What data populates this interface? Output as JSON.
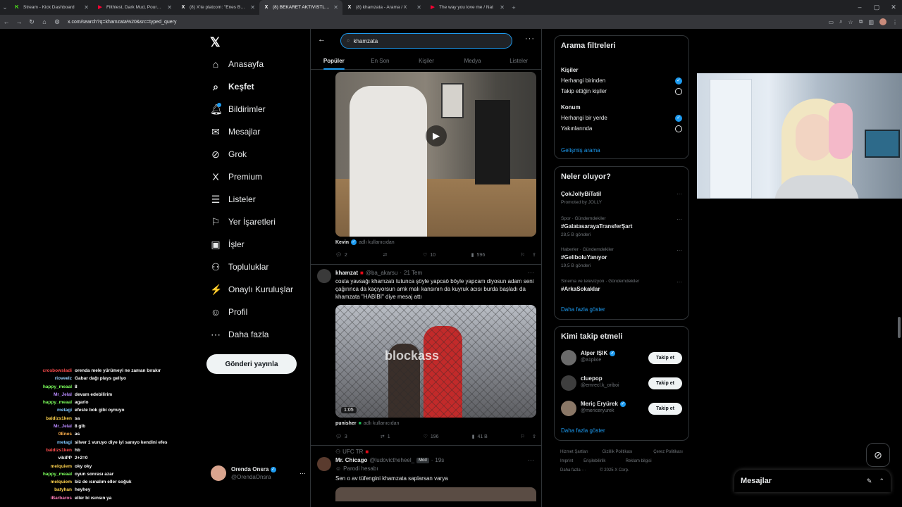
{
  "browser": {
    "tabs": [
      {
        "title": "Stream - Kick Dashboard",
        "icon": "K",
        "color": "#53fc18"
      },
      {
        "title": "Filthiest, Dark Mud, Poured Fro",
        "icon": "▶",
        "color": "#ff0033"
      },
      {
        "title": "(8) X'te platcom: \"Enes Batur, \"",
        "icon": "X",
        "color": "#ffffff"
      },
      {
        "title": "(8) BEKARET AKTIVİSTLERİ Top",
        "icon": "X",
        "color": "#ffffff"
      },
      {
        "title": "(8) khamzata - Arama / X",
        "icon": "X",
        "color": "#ffffff"
      },
      {
        "title": "The way you love me / Nat",
        "icon": "▶",
        "color": "#ff0033"
      }
    ],
    "active_tab": 3,
    "url": "x.com/search?q=khamzata%20&src=typed_query"
  },
  "nav": {
    "items": [
      {
        "label": "Anasayfa",
        "icon": "⌂",
        "icon_name": "home-icon"
      },
      {
        "label": "Keşfet",
        "icon": "⌕",
        "icon_name": "search-icon"
      },
      {
        "label": "Bildirimler",
        "icon": "🔔︎",
        "icon_name": "bell-icon"
      },
      {
        "label": "Mesajlar",
        "icon": "✉",
        "icon_name": "mail-icon"
      },
      {
        "label": "Grok",
        "icon": "⊘",
        "icon_name": "grok-icon"
      },
      {
        "label": "Premium",
        "icon": "X",
        "icon_name": "x-premium-icon"
      },
      {
        "label": "Listeler",
        "icon": "☰",
        "icon_name": "list-icon"
      },
      {
        "label": "Yer İşaretleri",
        "icon": "⚐",
        "icon_name": "bookmark-icon"
      },
      {
        "label": "İşler",
        "icon": "▣",
        "icon_name": "briefcase-icon"
      },
      {
        "label": "Topluluklar",
        "icon": "⚇",
        "icon_name": "communities-icon"
      },
      {
        "label": "Onaylı Kuruluşlar",
        "icon": "⚡",
        "icon_name": "lightning-icon"
      },
      {
        "label": "Profil",
        "icon": "☺",
        "icon_name": "profile-icon"
      },
      {
        "label": "Daha fazla",
        "icon": "⋯",
        "icon_name": "more-icon"
      }
    ],
    "post_button": "Gönderi yayınla",
    "account": {
      "name": "Orenda Onsra",
      "handle": "@OrendaOnsra"
    }
  },
  "search": {
    "query": "khamzata",
    "tabs": [
      "Popüler",
      "En Son",
      "Kişiler",
      "Medya",
      "Listeler"
    ]
  },
  "feed": {
    "post1": {
      "caption_name": "Kevin",
      "caption_suffix": "adlı kullanıcıdan",
      "replies": "2",
      "likes": "10",
      "views": "596"
    },
    "post2": {
      "name": "khamzat",
      "handle": "@ba_akarsu",
      "date": "21 Tem",
      "text": "costa yavsağı khamzatı tutunca şöyle yapcaö böyle yapcam diyosun adam seni çağırınca da kaçıyorsun amk malı kansının da kuyruk acısı burda başladı da khamzata \"HABİBİ\" diye mesaj attı",
      "duration": "1:05",
      "watermark": "blockass",
      "caption_name": "punisher",
      "caption_suffix": "adlı kullanıcıdan",
      "replies": "3",
      "retweets": "1",
      "likes": "196",
      "views": "41 B"
    },
    "post3": {
      "context": "UFC TR",
      "name": "Mr. Chicago",
      "handle": "@ludovictheheel_",
      "badge": "Mod",
      "time": "19s",
      "label": "Parodi hesabı",
      "text": "Sen o av tüfengini khamzata saplarsan varya"
    }
  },
  "filters": {
    "title": "Arama filtreleri",
    "people_title": "Kişiler",
    "people_opts": [
      "Herhangi birinden",
      "Takip ettiğin kişiler"
    ],
    "location_title": "Konum",
    "location_opts": [
      "Herhangi bir yerde",
      "Yakınlarında"
    ],
    "advanced": "Gelişmiş arama"
  },
  "trends": {
    "title": "Neler oluyor?",
    "items": [
      {
        "meta": "",
        "name": "ÇokJollyBiTatil",
        "sub": "Promoted by JOLLY"
      },
      {
        "meta": "Spor · Gündemdekiler",
        "name": "#GalatasarayaTransferŞart",
        "sub": "28,5 B gönderi"
      },
      {
        "meta": "Haberler · Gündemdekiler",
        "name": "#GeliboluYanıyor",
        "sub": "19,5 B gönderi"
      },
      {
        "meta": "Sinema ve televizyon · Gündemdekiler",
        "name": "#ArkaSokaklar",
        "sub": ""
      }
    ],
    "more": "Daha fazla göster"
  },
  "who_to_follow": {
    "title": "Kimi takip etmeli",
    "items": [
      {
        "name": "Alper IŞIK",
        "handle": "@a1pixie",
        "verified": true,
        "color": "#6b6b6b"
      },
      {
        "name": "cluepop",
        "handle": "@emrecl.k_oriboi",
        "verified": false,
        "color": "#3e3e3e"
      },
      {
        "name": "Meriç Eryürek",
        "handle": "@mericeryurek",
        "verified": true,
        "color": "#8a7766"
      }
    ],
    "follow_label": "Takip et",
    "more": "Daha fazla göster"
  },
  "footer": {
    "row1": [
      "Hizmet Şartları",
      "Gizlilik Politikası",
      "Çerez Politikası"
    ],
    "row2": [
      "Imprint",
      "Erişilebilirlik",
      "Reklam bilgisi"
    ],
    "row3": [
      "Daha fazla ···",
      "© 2025 X Corp."
    ]
  },
  "chat": [
    {
      "user": "crosbowsladi",
      "msg": "orenda mele yürümeyi ne zaman bırakır",
      "color": "#ff4d4d"
    },
    {
      "user": "rioveelz",
      "msg": "Gabar dağı plays geliyo",
      "color": "#9ad3ff"
    },
    {
      "user": "happy_meaal",
      "msg": "8",
      "color": "#7cff5c"
    },
    {
      "user": "Mr_Jelal",
      "msg": "devam edebilirim",
      "color": "#b98aff"
    },
    {
      "user": "happy_meaal",
      "msg": "agario",
      "color": "#7cff5c"
    },
    {
      "user": "metagi",
      "msg": "efeste bok gibi oynuyo",
      "color": "#7fc8ff"
    },
    {
      "user": "baldizs1ken",
      "msg": "sa",
      "color": "#ffd34d"
    },
    {
      "user": "Mr_Jelal",
      "msg": "8 glb",
      "color": "#b98aff"
    },
    {
      "user": "0Enes",
      "msg": "as",
      "color": "#ffb14d"
    },
    {
      "user": "metagi",
      "msg": "silver 1 vuruyo diye iyi sanıyo kendini efes",
      "color": "#7fc8ff"
    },
    {
      "user": "baldizs1ken",
      "msg": "hb",
      "color": "#ff4d4d"
    },
    {
      "user": "vikiPP",
      "msg": "2+2=0",
      "color": "#ffffff"
    },
    {
      "user": "melquiem",
      "msg": "oky oky",
      "color": "#ffd34d"
    },
    {
      "user": "happy_meaal",
      "msg": "oyun sonrası azar",
      "color": "#7cff5c"
    },
    {
      "user": "melquiem",
      "msg": "biz de ısınalım eller soğuk",
      "color": "#ffd34d"
    },
    {
      "user": "batyhan",
      "msg": "heyhey",
      "color": "#ffd34d"
    },
    {
      "user": "iBarbaros",
      "msg": "eller bi ısınsın ya",
      "color": "#ff7fb8"
    }
  ],
  "messages_drawer": {
    "title": "Mesajlar"
  }
}
